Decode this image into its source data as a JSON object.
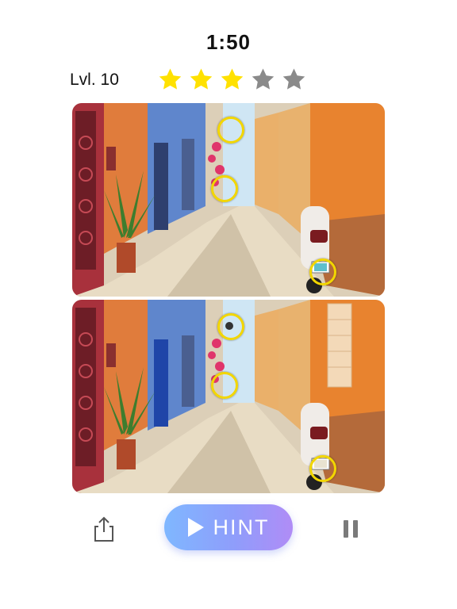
{
  "header": {
    "timer": "1:50",
    "level": "Lvl. 10",
    "stars": {
      "earned": 3,
      "total": 5
    }
  },
  "colors": {
    "star_filled": "#ffe100",
    "star_empty": "#8a8a8a",
    "circle": "#f2d600",
    "hint_gradient_start": "#7fb7ff",
    "hint_gradient_end": "#b08cf6"
  },
  "panels": {
    "top": {
      "found_differences": 3
    },
    "bottom": {
      "found_differences": 3
    }
  },
  "controls": {
    "share_icon": "share-icon",
    "hint_label": "HINT",
    "hint_icon": "play-icon",
    "pause_icon": "pause-icon"
  }
}
